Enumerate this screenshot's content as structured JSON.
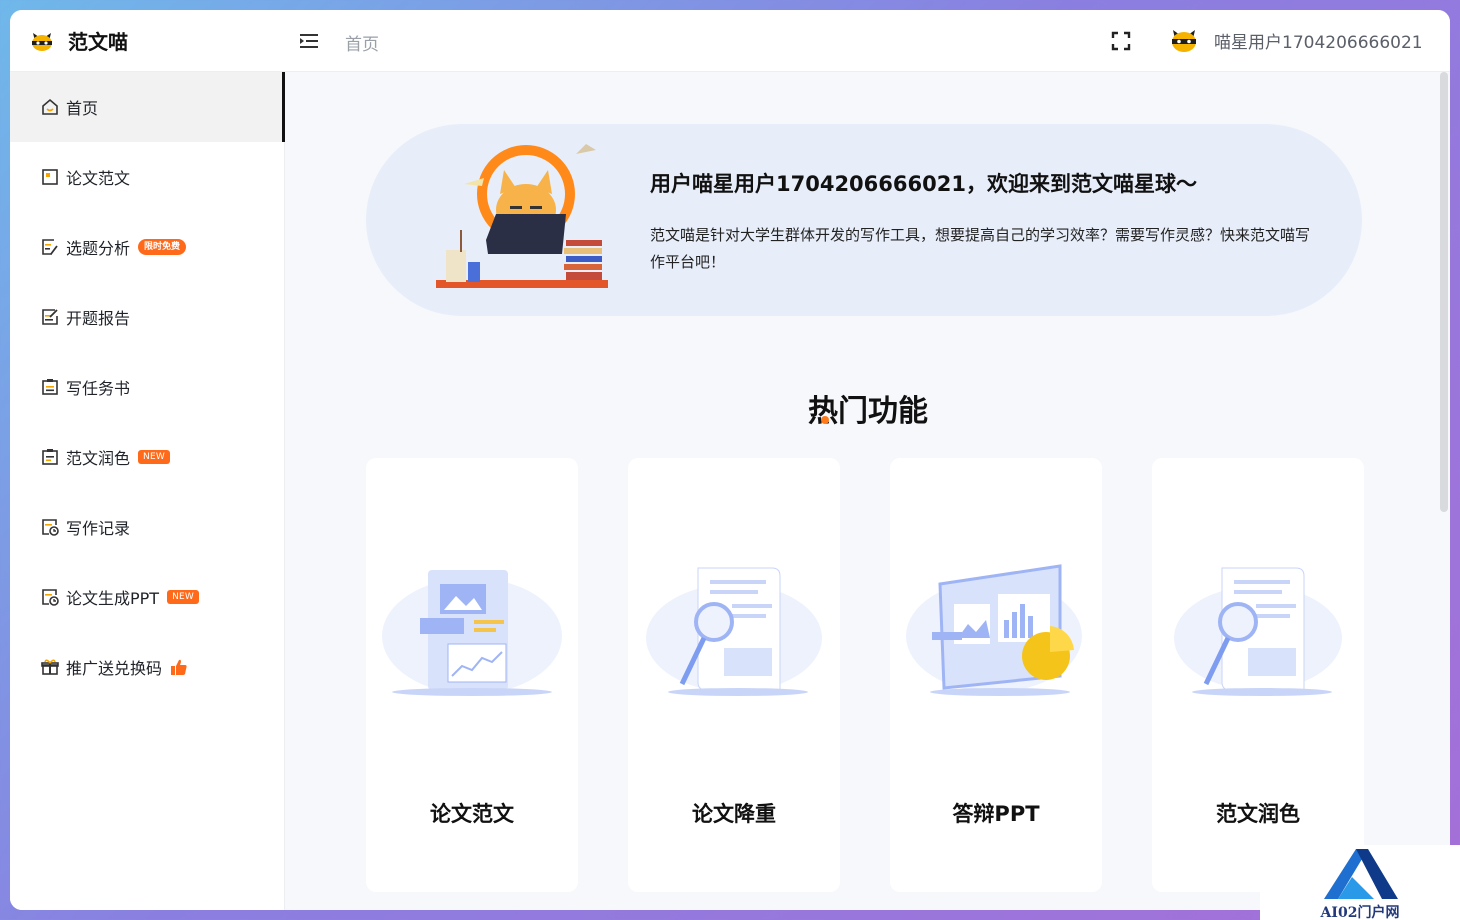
{
  "app": {
    "name": "范文喵",
    "colors": {
      "accent": "#ff6a1a",
      "active_bg": "#f2f2f3",
      "banner_bg": "#e8eef9",
      "illustration": "#9fb4f5"
    }
  },
  "header": {
    "breadcrumb": "首页",
    "username": "喵星用户1704206666021"
  },
  "sidebar": {
    "items": [
      {
        "label": "首页",
        "icon": "home-icon",
        "active": true
      },
      {
        "label": "论文范文",
        "icon": "paper-icon"
      },
      {
        "label": "选题分析",
        "icon": "edit-doc-icon",
        "badge": "限时免费"
      },
      {
        "label": "开题报告",
        "icon": "report-icon"
      },
      {
        "label": "写任务书",
        "icon": "task-icon"
      },
      {
        "label": "范文润色",
        "icon": "polish-icon",
        "badge": "NEW"
      },
      {
        "label": "写作记录",
        "icon": "history-icon"
      },
      {
        "label": "论文生成PPT",
        "icon": "ppt-icon",
        "badge": "NEW"
      },
      {
        "label": "推广送兑换码",
        "icon": "gift-icon"
      }
    ]
  },
  "banner": {
    "welcome": "用户喵星用户1704206666021，欢迎来到范文喵星球～",
    "description": "范文喵是针对大学生群体开发的写作工具，想要提高自己的学习效率？需要写作灵感？快来范文喵写作平台吧！"
  },
  "hot": {
    "title": "热门功能",
    "cards": [
      {
        "label": "论文范文",
        "icon": "document-chart-illustration"
      },
      {
        "label": "论文降重",
        "icon": "magnifier-document-illustration"
      },
      {
        "label": "答辩PPT",
        "icon": "presentation-chart-illustration"
      },
      {
        "label": "范文润色",
        "icon": "magnifier-document-illustration"
      }
    ]
  },
  "watermark": {
    "text": "AI02门户网"
  }
}
